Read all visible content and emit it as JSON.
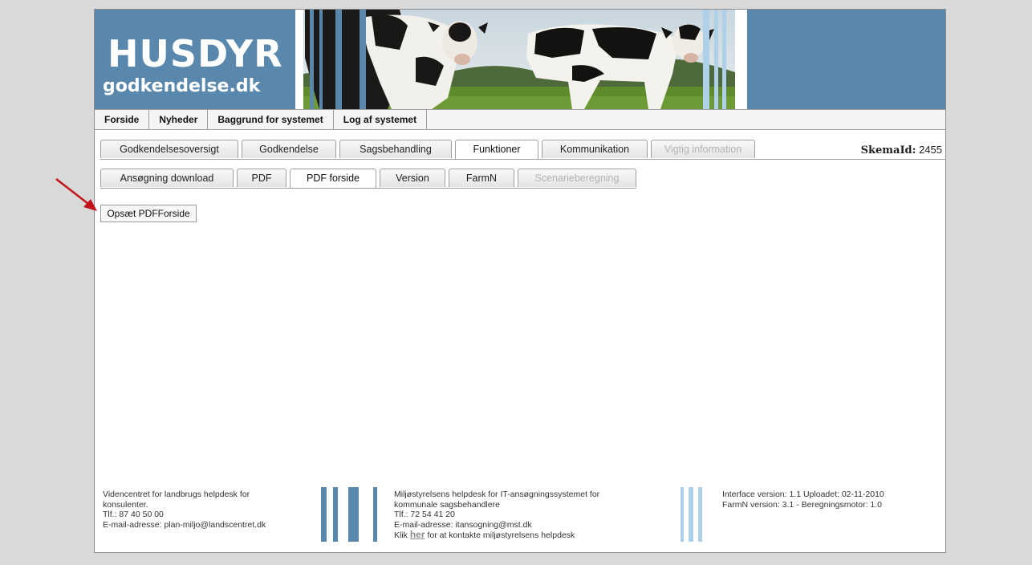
{
  "banner": {
    "logo_top": "HUSDYR",
    "logo_bottom": "godkendelse.dk"
  },
  "topnav": [
    "Forside",
    "Nyheder",
    "Baggrund for systemet",
    "Log af systemet"
  ],
  "tabs_main": [
    {
      "label": "Godkendelsesoversigt",
      "state": "normal"
    },
    {
      "label": "Godkendelse",
      "state": "normal"
    },
    {
      "label": "Sagsbehandling",
      "state": "normal"
    },
    {
      "label": "Funktioner",
      "state": "active"
    },
    {
      "label": "Kommunikation",
      "state": "normal"
    },
    {
      "label": "Vigtig information",
      "state": "disabled"
    }
  ],
  "tabs_sub": [
    {
      "label": "Ansøgning download",
      "state": "normal"
    },
    {
      "label": "PDF",
      "state": "normal"
    },
    {
      "label": "PDF forside",
      "state": "active"
    },
    {
      "label": "Version",
      "state": "normal"
    },
    {
      "label": "FarmN",
      "state": "normal"
    },
    {
      "label": "Scenarieberegning",
      "state": "disabled"
    }
  ],
  "skema": {
    "label": "SkemaId:",
    "value": "2455"
  },
  "action_button": "Opsæt PDFForside",
  "footer": {
    "col1": [
      "Videncentret for landbrugs helpdesk for",
      "konsulenter.",
      "Tlf.: 87 40 50 00",
      "E-mail-adresse: plan-miljo@landscentret.dk"
    ],
    "col2": [
      "Miljøstyrelsens helpdesk for IT-ansøgningssystemet for",
      "kommunale sagsbehandlere",
      "Tlf.: 72 54 41 20",
      "E-mail-adresse: itansogning@mst.dk"
    ],
    "col2_link_prefix": "Klik",
    "col2_link": "her",
    "col2_link_suffix": "for at kontakte miljøstyrelsens helpdesk",
    "col3": [
      "Interface version: 1.1 Uploadet: 02-11-2010",
      "FarmN version: 3.1 - Beregningsmotor: 1.0"
    ]
  },
  "colors": {
    "banner": "#5a88ad",
    "stripe_dark": "#5a88ad",
    "stripe_light": "#aed0e8",
    "arrow": "#c0121b"
  }
}
